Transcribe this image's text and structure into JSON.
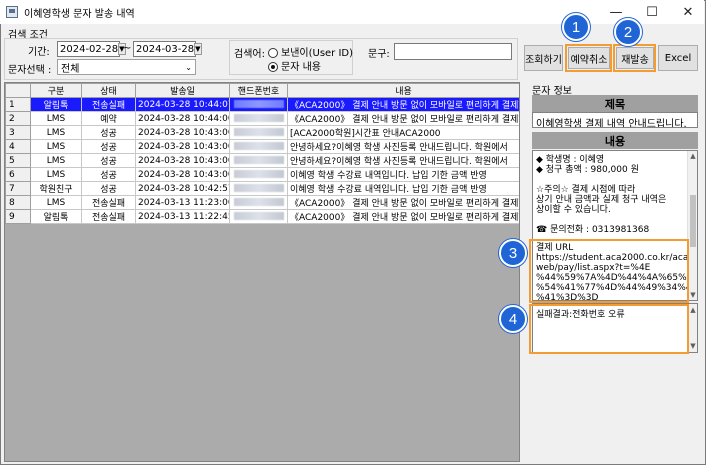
{
  "window": {
    "title": "이혜영학생 문자 발송 내역",
    "controls": {
      "minimize": "—",
      "maximize": "☐",
      "close": "✕"
    }
  },
  "search": {
    "group_label": "검색 조건",
    "period_label": "기간:",
    "date_from": "2024-02-28",
    "date_sep": "~",
    "date_to": "2024-03-28",
    "msg_select_label": "문자선택 :",
    "msg_select_value": "전체",
    "search_field_label": "검색어:",
    "radio_sender": "보낸이(User ID)",
    "radio_content": "문자 내용",
    "phrase_label": "문구:",
    "phrase_value": ""
  },
  "buttons": {
    "search": "조회하기",
    "cancel_reservation": "예약취소",
    "resend": "재발송",
    "excel": "Excel"
  },
  "callouts": {
    "n1": "1",
    "n2": "2",
    "n3": "3",
    "n4": "4"
  },
  "grid": {
    "headers": [
      "구분",
      "상태",
      "발송일",
      "핸드폰번호",
      "내용"
    ],
    "rows": [
      {
        "no": "1",
        "type": "알림톡",
        "status": "전송실패",
        "date": "2024-03-28 10:44:07",
        "content": "《ACA2000》 결제 안내 방문 없이 모바일로 편리하게 결제하"
      },
      {
        "no": "2",
        "type": "LMS",
        "status": "예약",
        "date": "2024-03-28 10:44:00",
        "content": "《ACA2000》 결제 안내 방문 없이 모바일로 편리하게 결제하"
      },
      {
        "no": "3",
        "type": "LMS",
        "status": "성공",
        "date": "2024-03-28 10:43:00",
        "content": "[ACA2000학원]시간표 안내ACA2000"
      },
      {
        "no": "4",
        "type": "LMS",
        "status": "성공",
        "date": "2024-03-28 10:43:00",
        "content": "안녕하세요?이혜영 학생 사진등록 안내드립니다. 학원에서"
      },
      {
        "no": "5",
        "type": "LMS",
        "status": "성공",
        "date": "2024-03-28 10:43:00",
        "content": "안녕하세요?이혜영 학생 사진등록 안내드립니다. 학원에서"
      },
      {
        "no": "6",
        "type": "LMS",
        "status": "성공",
        "date": "2024-03-28 10:43:00",
        "content": "이혜영 학생 수강료 내역입니다. 납입 기한   금액   반영"
      },
      {
        "no": "7",
        "type": "학원친구",
        "status": "성공",
        "date": "2024-03-28 10:42:57",
        "content": "이혜영 학생 수강료 내역입니다. 납입 기한   금액   반영"
      },
      {
        "no": "8",
        "type": "LMS",
        "status": "전송실패",
        "date": "2024-03-13 11:23:00",
        "content": "《ACA2000》 결제 안내 방문 없이 모바일로 편리하게 결제하"
      },
      {
        "no": "9",
        "type": "알림톡",
        "status": "전송실패",
        "date": "2024-03-13 11:22:45",
        "content": "《ACA2000》 결제 안내 방문 없이 모바일로 편리하게 결제하"
      }
    ]
  },
  "info": {
    "section_label": "문자 정보",
    "subject_header": "제목",
    "subject_value": "이혜영학생 결제 내역 안내드립니다.",
    "content_header": "내용",
    "content_lines": [
      "◆ 학생명 : 이혜영",
      "◆ 청구 총액 : 980,000 원",
      "",
      "☆주의☆ 결제 시점에 따라",
      "상기 안내 금액과 실제 청구 내역은",
      "상이할 수 있습니다.",
      "",
      "☎ 문의전화 : 0313981368"
    ],
    "url_lines": [
      "결제 URL",
      "https://student.aca2000.co.kr/aca",
      "web/pay/list.aspx?t=%4E",
      "%44%59%7A%4D%44%4A%65%4D",
      "%54%41%77%4D%44%49%34%4D",
      "%41%3D%3D"
    ],
    "result_text": "실패결과:전화번호 오류"
  }
}
